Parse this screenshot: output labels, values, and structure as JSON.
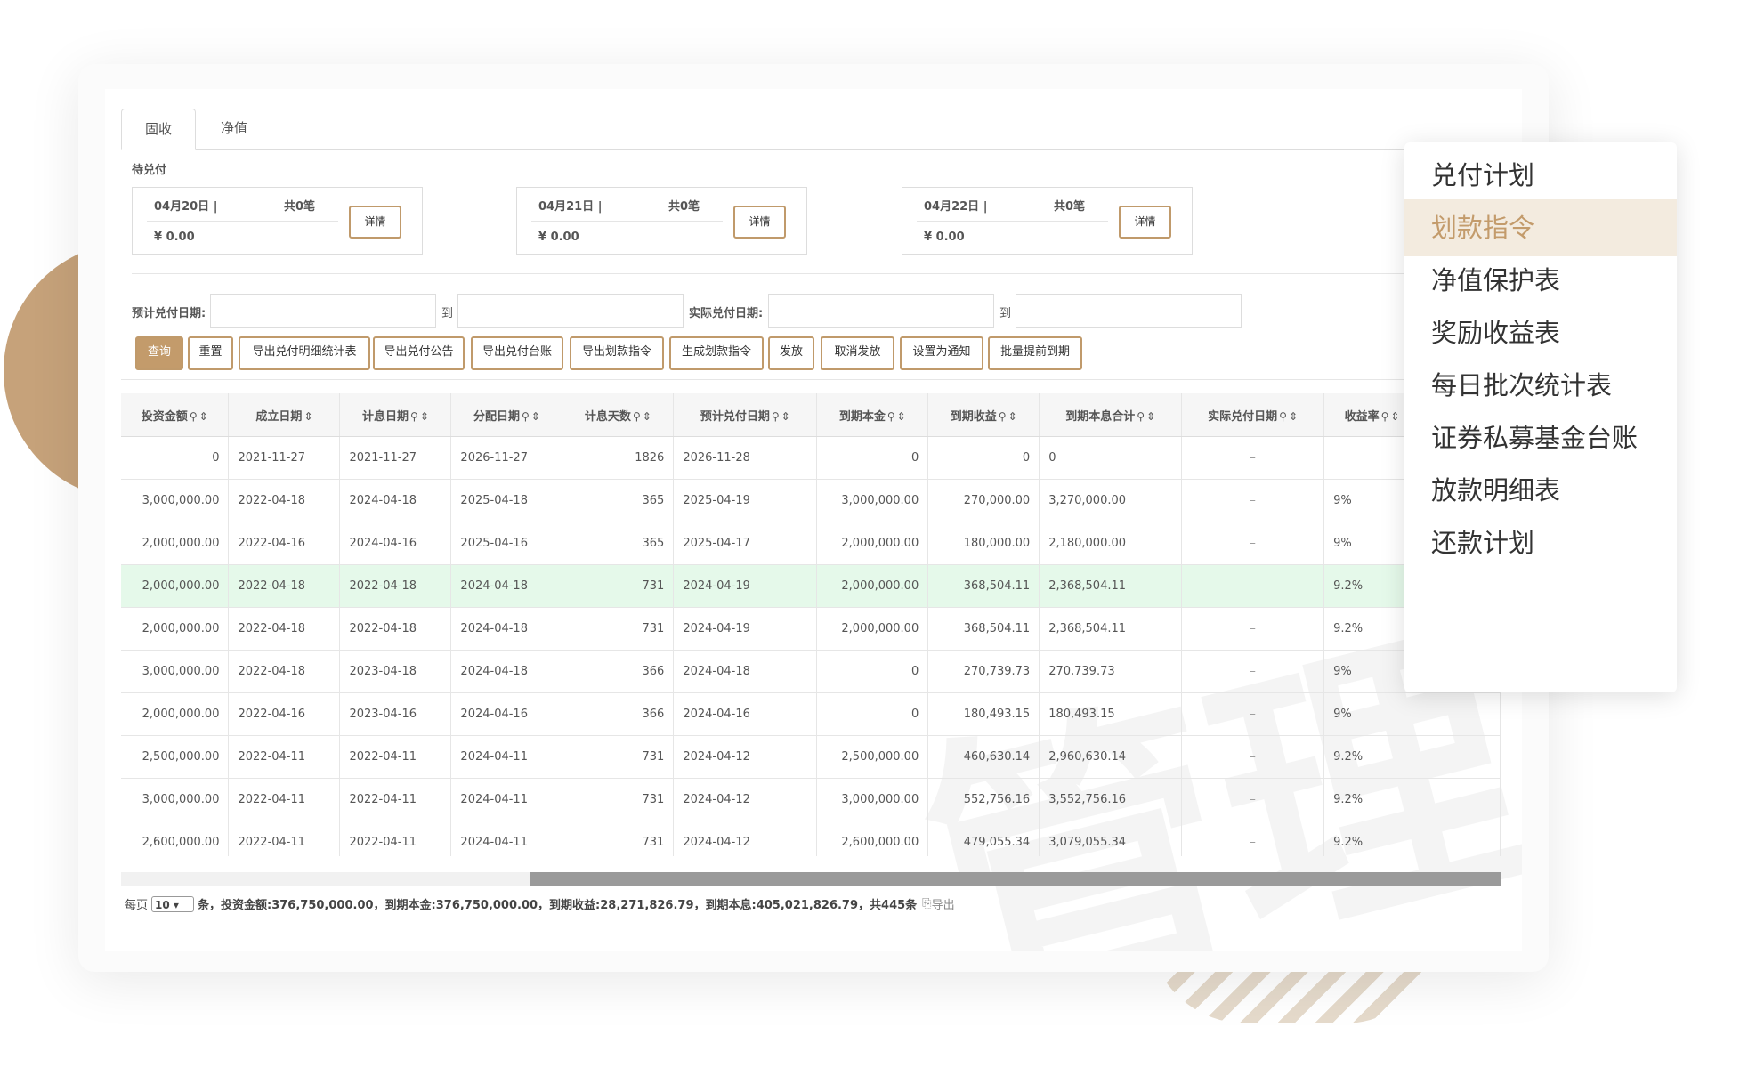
{
  "tabs": [
    {
      "label": "固收"
    },
    {
      "label": "净值"
    }
  ],
  "pending": {
    "title": "待兑付",
    "boxes": [
      {
        "date": "04月20日  |",
        "count": "共0笔",
        "amount": "¥ 0.00",
        "button": "详情"
      },
      {
        "date": "04月21日  |",
        "count": "共0笔",
        "amount": "¥ 0.00",
        "button": "详情"
      },
      {
        "date": "04月22日  |",
        "count": "共0笔",
        "amount": "¥ 0.00",
        "button": "详情"
      }
    ]
  },
  "filters": {
    "expected_label": "预计兑付日期:",
    "to1": "到",
    "actual_label": "实际兑付日期:",
    "to2": "到"
  },
  "buttons": [
    "查询",
    "重置",
    "导出兑付明细统计表",
    "导出兑付公告",
    "导出兑付台账",
    "导出划款指令",
    "生成划款指令",
    "发放",
    "取消发放",
    "设置为通知",
    "批量提前到期"
  ],
  "table": {
    "columns": [
      "投资金额",
      "成立日期",
      "计息日期",
      "分配日期",
      "计息天数",
      "预计兑付日期",
      "到期本金",
      "到期收益",
      "到期本息合计",
      "实际兑付日期",
      "收益率"
    ],
    "rows": [
      [
        "0",
        "2021-11-27",
        "2021-11-27",
        "2026-11-27",
        "1826",
        "2026-11-28",
        "0",
        "0",
        "0",
        "–",
        ""
      ],
      [
        "3,000,000.00",
        "2022-04-18",
        "2024-04-18",
        "2025-04-18",
        "365",
        "2025-04-19",
        "3,000,000.00",
        "270,000.00",
        "3,270,000.00",
        "–",
        "9%"
      ],
      [
        "2,000,000.00",
        "2022-04-16",
        "2024-04-16",
        "2025-04-16",
        "365",
        "2025-04-17",
        "2,000,000.00",
        "180,000.00",
        "2,180,000.00",
        "–",
        "9%"
      ],
      [
        "2,000,000.00",
        "2022-04-18",
        "2022-04-18",
        "2024-04-18",
        "731",
        "2024-04-19",
        "2,000,000.00",
        "368,504.11",
        "2,368,504.11",
        "–",
        "9.2%"
      ],
      [
        "2,000,000.00",
        "2022-04-18",
        "2022-04-18",
        "2024-04-18",
        "731",
        "2024-04-19",
        "2,000,000.00",
        "368,504.11",
        "2,368,504.11",
        "–",
        "9.2%"
      ],
      [
        "3,000,000.00",
        "2022-04-18",
        "2023-04-18",
        "2024-04-18",
        "366",
        "2024-04-18",
        "0",
        "270,739.73",
        "270,739.73",
        "–",
        "9%"
      ],
      [
        "2,000,000.00",
        "2022-04-16",
        "2023-04-16",
        "2024-04-16",
        "366",
        "2024-04-16",
        "0",
        "180,493.15",
        "180,493.15",
        "–",
        "9%"
      ],
      [
        "2,500,000.00",
        "2022-04-11",
        "2022-04-11",
        "2024-04-11",
        "731",
        "2024-04-12",
        "2,500,000.00",
        "460,630.14",
        "2,960,630.14",
        "–",
        "9.2%"
      ],
      [
        "3,000,000.00",
        "2022-04-11",
        "2022-04-11",
        "2024-04-11",
        "731",
        "2024-04-12",
        "3,000,000.00",
        "552,756.16",
        "3,552,756.16",
        "–",
        "9.2%"
      ],
      [
        "2,600,000.00",
        "2022-04-11",
        "2022-04-11",
        "2024-04-11",
        "731",
        "2024-04-12",
        "2,600,000.00",
        "479,055.34",
        "3,079,055.34",
        "–",
        "9.2%"
      ]
    ],
    "highlight_row_index": 3
  },
  "footer": {
    "per_page_prefix": "每页",
    "per_page_value": "10",
    "summary": "条，投资金额:376,750,000.00，到期本金:376,750,000.00，到期收益:28,271,826.79，到期本息:405,021,826.79，共445条",
    "export": "导出"
  },
  "menu": {
    "items": [
      "兑付计划",
      "划款指令",
      "净值保护表",
      "奖励收益表",
      "每日批次统计表",
      "证券私募基金台账",
      "放款明细表",
      "还款计划"
    ],
    "active_index": 1
  },
  "watermark": "管理",
  "colors": {
    "accent": "#c39b6b",
    "highlight_row": "#e5f9ea",
    "deco_circle": "#c6a27a"
  }
}
